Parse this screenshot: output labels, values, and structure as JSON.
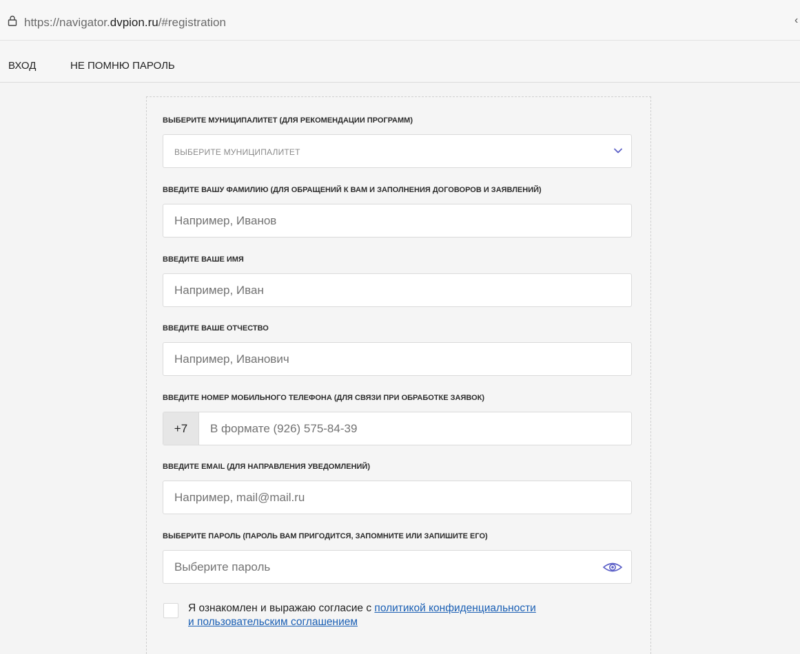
{
  "browser": {
    "url_prefix": "https://navigator.",
    "url_host": "dvpion.ru",
    "url_suffix": "/#registration"
  },
  "nav": {
    "login": "ВХОД",
    "forgot_password": "НЕ ПОМНЮ ПАРОЛЬ"
  },
  "form": {
    "municipality": {
      "label": "ВЫБЕРИТЕ МУНИЦИПАЛИТЕТ (ДЛЯ РЕКОМЕНДАЦИИ ПРОГРАММ)",
      "selected": "ВЫБЕРИТЕ МУНИЦИПАЛИТЕТ"
    },
    "surname": {
      "label": "ВВЕДИТЕ ВАШУ ФАМИЛИЮ (ДЛЯ ОБРАЩЕНИЙ К ВАМ И ЗАПОЛНЕНИЯ ДОГОВОРОВ И ЗАЯВЛЕНИЙ)",
      "placeholder": "Например, Иванов",
      "value": ""
    },
    "name": {
      "label": "ВВЕДИТЕ ВАШЕ ИМЯ",
      "placeholder": "Например, Иван",
      "value": ""
    },
    "patronymic": {
      "label": "ВВЕДИТЕ ВАШЕ ОТЧЕСТВО",
      "placeholder": "Например, Иванович",
      "value": ""
    },
    "phone": {
      "label": "ВВЕДИТЕ НОМЕР МОБИЛЬНОГО ТЕЛЕФОНА (ДЛЯ СВЯЗИ ПРИ ОБРАБОТКЕ ЗАЯВОК)",
      "prefix": "+7",
      "placeholder": "В формате (926) 575-84-39",
      "value": ""
    },
    "email": {
      "label": "ВВЕДИТЕ EMAIL (ДЛЯ НАПРАВЛЕНИЯ УВЕДОМЛЕНИЙ)",
      "placeholder": "Например, mail@mail.ru",
      "value": ""
    },
    "password": {
      "label": "ВЫБЕРИТЕ ПАРОЛЬ (ПАРОЛЬ ВАМ ПРИГОДИТСЯ, ЗАПОМНИТЕ ИЛИ ЗАПИШИТЕ ЕГО)",
      "placeholder": "Выберите пароль",
      "value": "",
      "toggle_icon": "eye-icon"
    },
    "consent": {
      "checked": false,
      "text": "Я ознакомлен и выражаю согласие с ",
      "link_1": "политикой конфиденциальности",
      "link_2": "и пользовательским соглашением"
    }
  },
  "colors": {
    "link": "#1a5fb4",
    "icon_accent": "#5b5fc7",
    "page_bg": "#f4f4f4"
  }
}
